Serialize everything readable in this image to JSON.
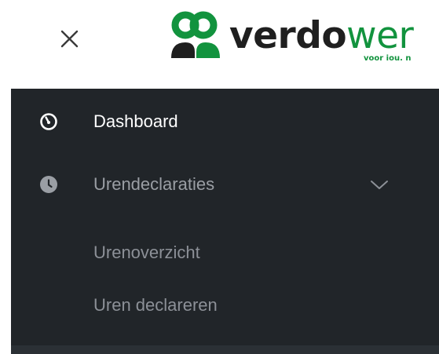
{
  "header": {
    "close_icon": "close-icon",
    "logo": {
      "word_dark": "verdo",
      "word_green": "wer",
      "tagline": "voor iou. n",
      "brand_green": "#12933e"
    }
  },
  "sidebar": {
    "background": "#212529",
    "items": [
      {
        "label": "Dashboard",
        "icon": "dashboard-gauge-icon",
        "color": "#ffffff"
      },
      {
        "label": "Urendeclaraties",
        "icon": "clock-icon",
        "color": "#9a9ea4",
        "expanded_indicator": "chevron-down-icon"
      }
    ],
    "subitems": [
      {
        "label": "Urenoverzicht"
      },
      {
        "label": "Uren declareren"
      }
    ]
  }
}
